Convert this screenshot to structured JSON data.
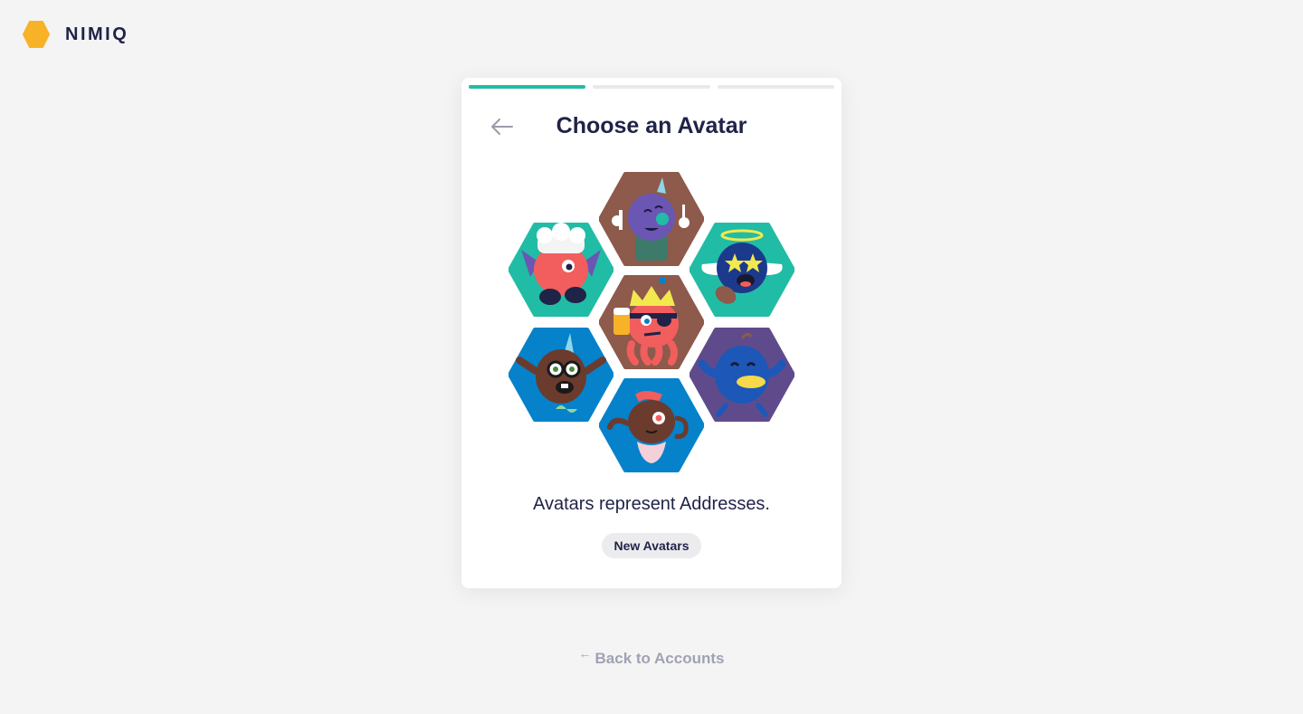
{
  "brand": {
    "name": "NIMIQ",
    "logo_color": "#f7b228",
    "logo_icon": "hexagon-logo-icon"
  },
  "progress": {
    "steps": 3,
    "current": 1,
    "active_color": "#21bca5",
    "inactive_color": "#e9e9ec"
  },
  "card": {
    "title": "Choose an Avatar",
    "back_icon": "arrow-left-icon",
    "caption": "Avatars represent Addresses.",
    "new_button_label": "New Avatars"
  },
  "avatars": [
    {
      "name": "purple-unicorn-chef",
      "bg": "#8d5a4b",
      "body": "#6b56b3"
    },
    {
      "name": "red-chef-goblin",
      "bg": "#21bca5",
      "body": "#f25d5d"
    },
    {
      "name": "blue-angel-bird",
      "bg": "#21bca5",
      "body": "#1b3a8c"
    },
    {
      "name": "red-king-pirate-octopus",
      "bg": "#8d5a4b",
      "body": "#f25d5d"
    },
    {
      "name": "brown-nerd-unicorn",
      "bg": "#0582ca",
      "body": "#6b3b2e"
    },
    {
      "name": "blue-duck-bird",
      "bg": "#5f4b8b",
      "body": "#1d58b8"
    },
    {
      "name": "brown-teapot-pirate",
      "bg": "#0582ca",
      "body": "#6b3b2e"
    }
  ],
  "footer": {
    "back_label": "Back to Accounts",
    "back_icon": "arrow-left-icon"
  }
}
